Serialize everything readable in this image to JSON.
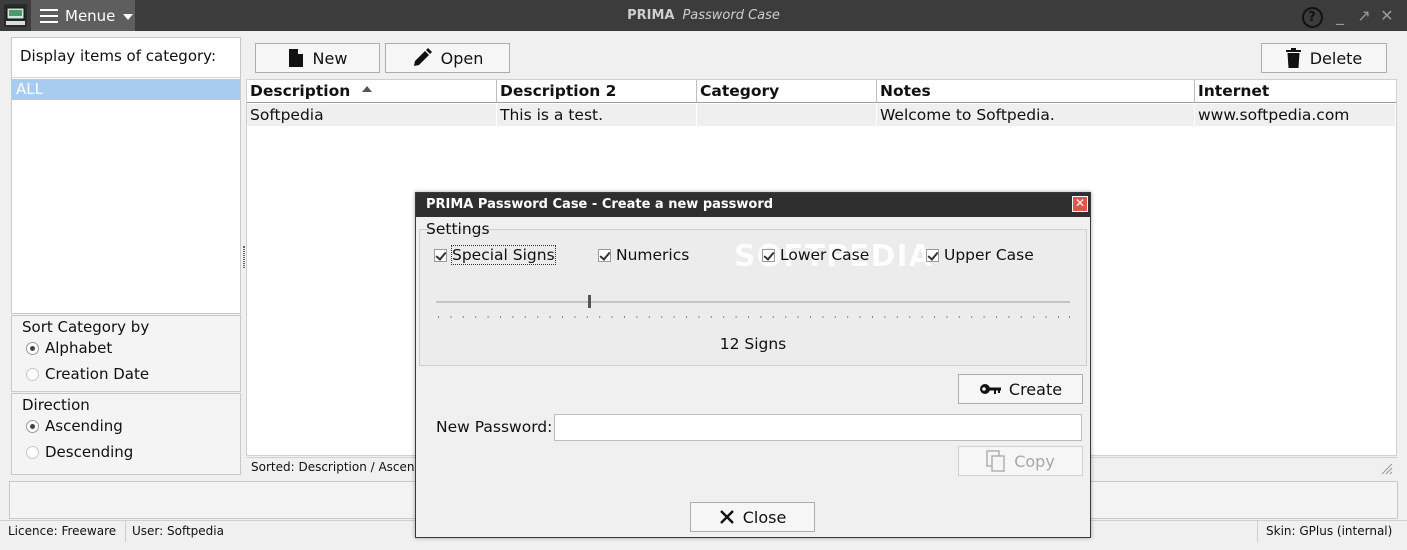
{
  "app": {
    "title_bold": "PRIMA",
    "title_italic": "Password Case",
    "menu_label": "Menue"
  },
  "window_controls": {
    "help": "?",
    "minimize": "_",
    "maximize": "↗",
    "close": "✕"
  },
  "category": {
    "header": "Display items of category:",
    "items": [
      {
        "label": "ALL",
        "selected": true
      }
    ]
  },
  "sort_category": {
    "title": "Sort Category by",
    "options": [
      {
        "label": "Alphabet",
        "checked": true
      },
      {
        "label": "Creation Date",
        "checked": false
      }
    ]
  },
  "direction": {
    "title": "Direction",
    "options": [
      {
        "label": "Ascending",
        "checked": true
      },
      {
        "label": "Descending",
        "checked": false
      }
    ]
  },
  "toolbar": {
    "new_label": "New",
    "open_label": "Open",
    "delete_label": "Delete"
  },
  "table": {
    "columns": [
      "Description",
      "Description 2",
      "Category",
      "Notes",
      "Internet"
    ],
    "sorted_column": "Description",
    "rows": [
      [
        "Softpedia",
        "This is a test.",
        "",
        "Welcome to Softpedia.",
        "www.softpedia.com"
      ]
    ]
  },
  "sorted_status": "Sorted: Description / Ascending",
  "status": {
    "licence": "Licence: Freeware",
    "user": "User: Softpedia",
    "skin": "Skin: GPlus (internal)"
  },
  "dialog": {
    "title": "PRIMA Password Case - Create a new password",
    "close": "✕",
    "settings_title": "Settings",
    "watermark": "SOFTPEDIA",
    "checkboxes": [
      {
        "label": "Special Signs",
        "checked": true
      },
      {
        "label": "Numerics",
        "checked": true
      },
      {
        "label": "Lower Case",
        "checked": true
      },
      {
        "label": "Upper Case",
        "checked": true
      }
    ],
    "slider_value": 12,
    "signs_label": "12 Signs",
    "create_label": "Create",
    "new_password_label": "New Password:",
    "new_password_value": "",
    "copy_label": "Copy",
    "close_label": "Close"
  },
  "colors": {
    "titlebar": "#3c3c3c",
    "menu_button": "#5e5e5e",
    "selection": "#a7ccf0",
    "dialog_title": "#2f2f2f",
    "dialog_close": "#e0554d"
  },
  "icons": [
    "app-icon",
    "hamburger-icon",
    "chevron-down-icon",
    "help-icon",
    "minimize-icon",
    "maximize-icon",
    "close-icon",
    "new-document-icon",
    "pencil-icon",
    "trash-icon",
    "sort-ascending-icon",
    "key-icon",
    "copy-icon",
    "resize-grip-icon"
  ]
}
